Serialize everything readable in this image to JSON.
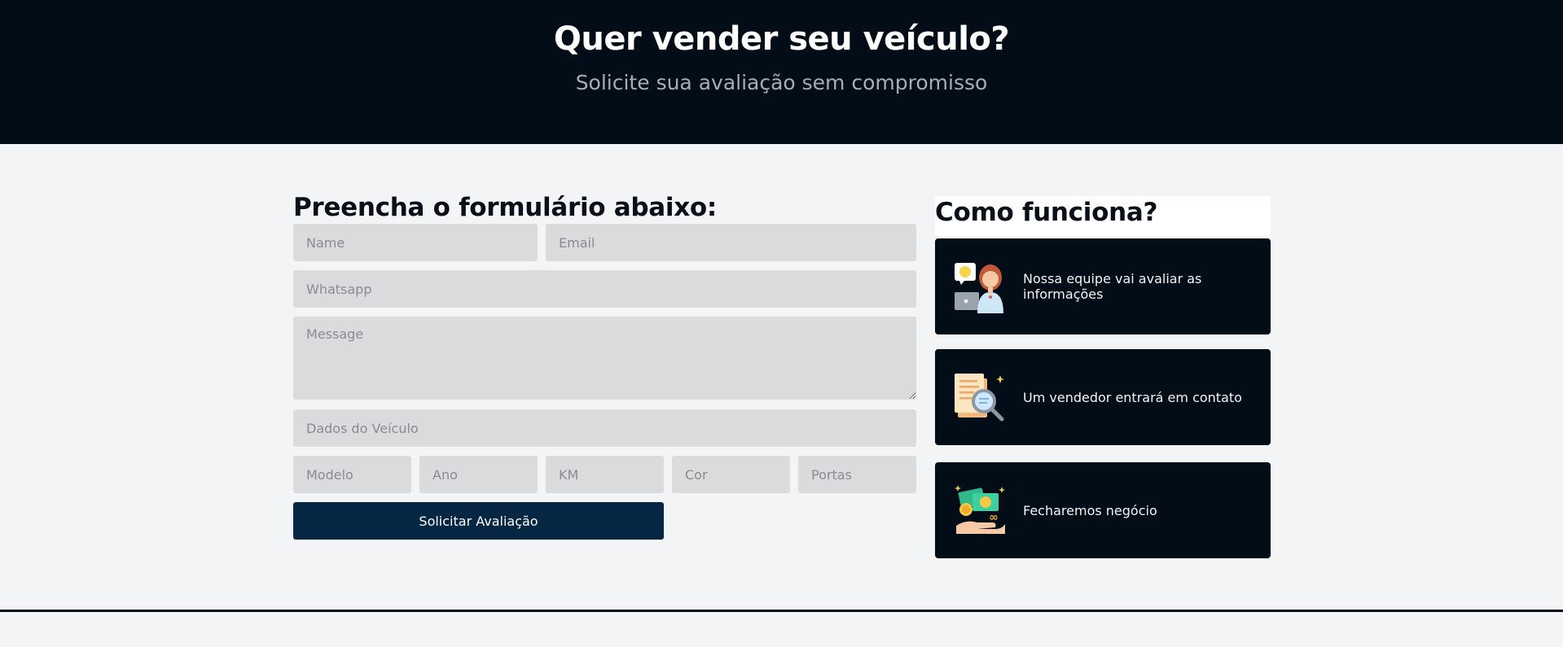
{
  "hero": {
    "title": "Quer vender seu veículo?",
    "subtitle": "Solicite sua avaliação sem compromisso"
  },
  "form": {
    "title": "Preencha o formulário abaixo:",
    "fields": {
      "name": "Name",
      "email": "Email",
      "whatsapp": "Whatsapp",
      "message": "Message",
      "vehicle": "Dados do Veículo",
      "model": "Modelo",
      "year": "Ano",
      "km": "KM",
      "color": "Cor",
      "doors": "Portas"
    },
    "submit_label": "Solicitar Avaliação"
  },
  "how": {
    "title": "Como funciona?",
    "steps": [
      {
        "icon": "support-agent-icon",
        "text": "Nossa equipe vai avaliar as informações"
      },
      {
        "icon": "document-search-icon",
        "text": "Um vendedor entrará em contato"
      },
      {
        "icon": "money-hand-icon",
        "text": "Fecharemos negócio"
      }
    ]
  },
  "colors": {
    "dark_bg": "#020d18",
    "button_bg": "#052744",
    "input_bg": "#dadbdd",
    "page_bg": "#f3f4f6"
  }
}
